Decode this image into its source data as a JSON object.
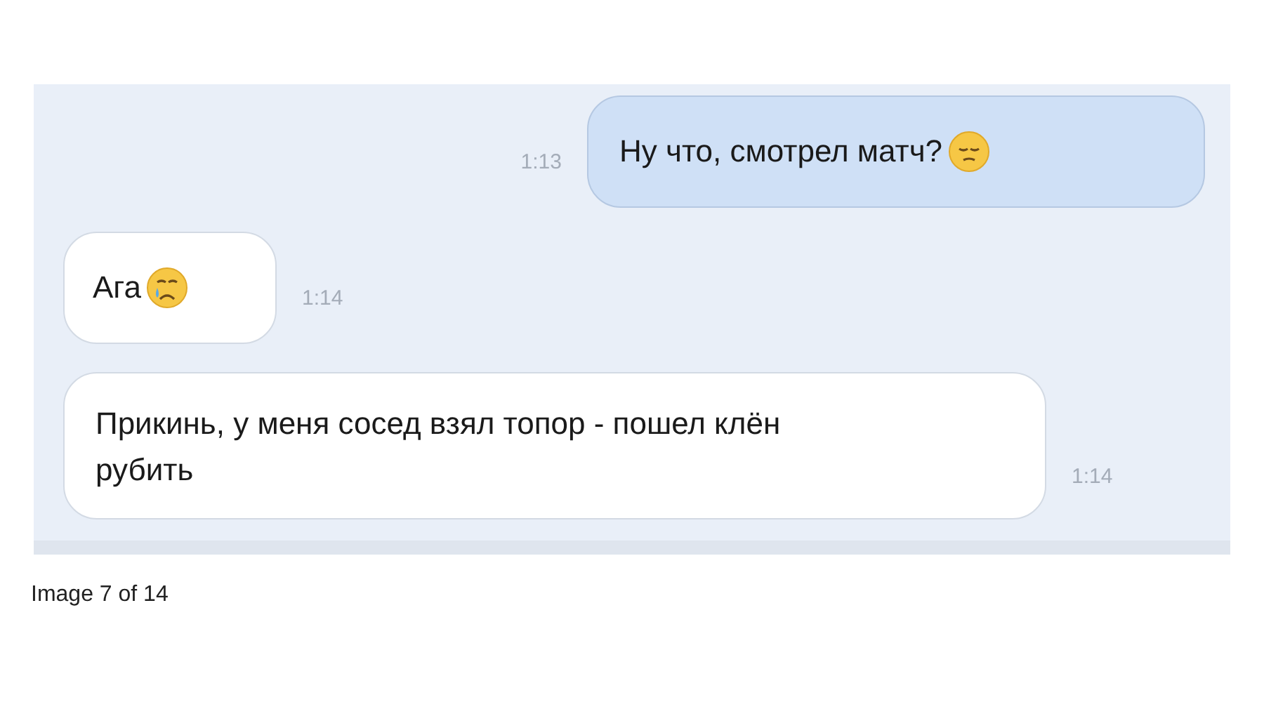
{
  "messages": [
    {
      "kind": "outgoing",
      "text": "Ну что, смотрел матч?",
      "emoji": {
        "kind": "pensive"
      },
      "time": "1:13"
    },
    {
      "kind": "incoming",
      "text": "Ага",
      "emoji": {
        "kind": "crying"
      },
      "time": "1:14"
    },
    {
      "kind": "incoming",
      "text": "Прикинь, у меня сосед взял топор - пошел клён рубить",
      "time": "1:14"
    }
  ],
  "caption": "Image 7 of 14"
}
